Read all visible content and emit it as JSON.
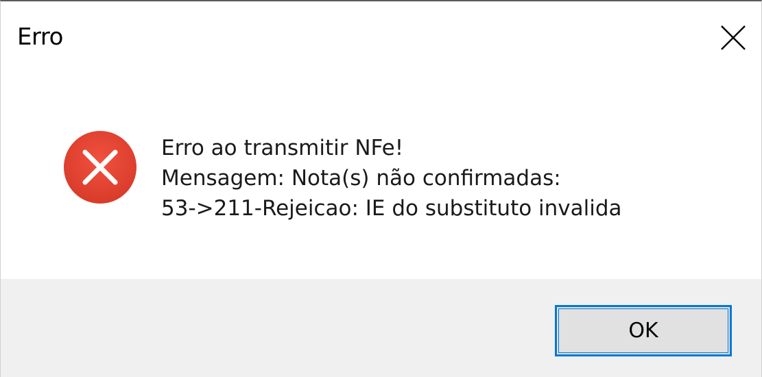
{
  "window": {
    "title": "Erro"
  },
  "titlebar": {
    "close_icon": "close-x-icon"
  },
  "message": {
    "icon": "error-circle-x-icon",
    "lines": [
      "Erro ao transmitir NFe!",
      "Mensagem: Nota(s) não confirmadas:",
      "53->211-Rejeicao: IE do substituto invalida"
    ]
  },
  "buttons": {
    "ok_label": "OK"
  },
  "colors": {
    "error_red": "#e81123",
    "accent_blue": "#0078d7",
    "footer_bg": "#f0f0f0",
    "button_bg": "#e1e1e1"
  }
}
